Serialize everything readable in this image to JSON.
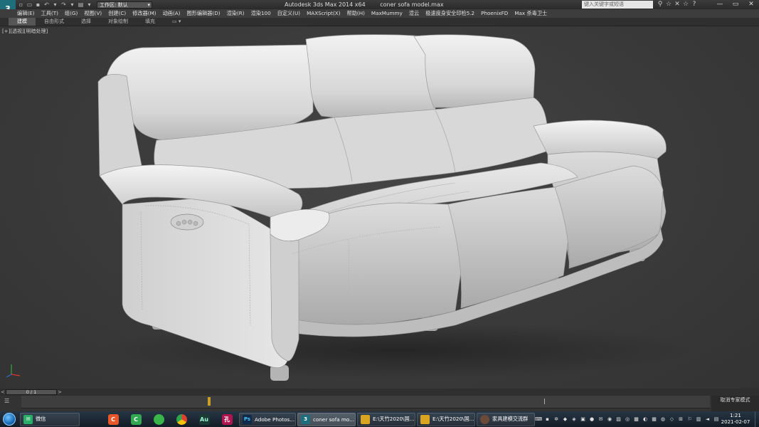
{
  "titlebar": {
    "workspace_label": "工作区: 默认",
    "app_title": "Autodesk 3ds Max  2014 x64",
    "file_title": "coner sofa model.max",
    "search_placeholder": "键入关键字或短语",
    "window_buttons": [
      "—",
      "▭",
      "✕"
    ]
  },
  "menu": {
    "items": [
      "编辑(E)",
      "工具(T)",
      "组(G)",
      "视图(V)",
      "创建(C)",
      "修改器(M)",
      "动画(A)",
      "图形编辑器(D)",
      "渲染(R)",
      "渲染100",
      "自定义(U)",
      "MAXScript(X)",
      "帮助(H)",
      "MaxMummy",
      "渲云",
      "极速度身安全印检5.2",
      "PhoenixFD",
      "Max 杀毒卫士"
    ]
  },
  "ribbon": {
    "tabs": [
      "建模",
      "自由形式",
      "选择",
      "对象绘制",
      "填充"
    ]
  },
  "viewport": {
    "label": "[+][透视][明暗处理]"
  },
  "timeline": {
    "frame": "0 / 1",
    "prev_arrow": "<",
    "next_arrow": ">"
  },
  "status": {
    "line1": "取消专家模式"
  },
  "taskbar": {
    "tasks": [
      {
        "label": "微信",
        "color": "#2aae67"
      },
      {
        "label": "Adobe Photos...",
        "color": "#0f2a4a"
      },
      {
        "label": "coner sofa mo...",
        "color": "#1e6f7b"
      },
      {
        "label": "E:\\天竹2020\\国...",
        "color": "#d9a520"
      },
      {
        "label": "E:\\天竹2020\\国...",
        "color": "#d9a520"
      },
      {
        "label": "家具建模交流群",
        "color": "#6b4a3a"
      }
    ],
    "pins": [
      {
        "label": "C",
        "color": "#e8572a"
      },
      {
        "label": "C",
        "color": "#33a853"
      },
      {
        "label": "",
        "color": "#3ab54a"
      },
      {
        "label": "",
        "color": "#e0412f"
      },
      {
        "label": "Au",
        "color": "#1a3b33"
      },
      {
        "label": "孔",
        "color": "#b0154f"
      }
    ],
    "clock_time": "1:21",
    "clock_date": "2021-02-07"
  }
}
